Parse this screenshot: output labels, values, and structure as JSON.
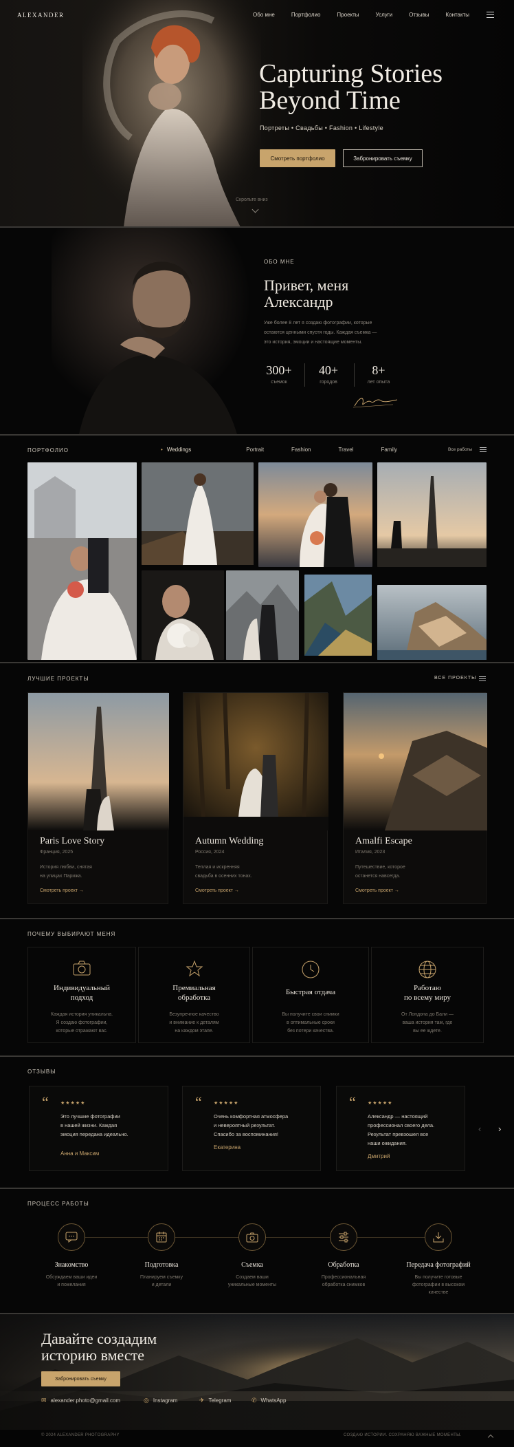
{
  "brand": "ALEXANDER",
  "nav": {
    "items": [
      "Обо мне",
      "Портфолио",
      "Проекты",
      "Услуги",
      "Отзывы",
      "Контакты"
    ]
  },
  "hero": {
    "title_line1": "Capturing Stories",
    "title_line2": "Beyond Time",
    "subtitle": "Портреты • Свадьбы • Fashion • Lifestyle",
    "primary_button": "Смотреть портфолио",
    "secondary_button": "Забронировать съемку",
    "scroll_hint": "Скрольте вниз"
  },
  "about": {
    "label": "ОБО МНЕ",
    "title_line1": "Привет, меня",
    "title_line2": "Александр",
    "text_line1": "Уже более 8 лет я создаю фотографии, которые",
    "text_line2": "остаются ценными спустя годы. Каждая съемка —",
    "text_line3": "это история, эмоции и настоящие моменты.",
    "stats": [
      {
        "value": "300+",
        "label": "съемок"
      },
      {
        "value": "40+",
        "label": "городов"
      },
      {
        "value": "8+",
        "label": "лет опыта"
      }
    ]
  },
  "portfolio": {
    "label": "ПОРТФОЛИО",
    "tabs": [
      "Weddings",
      "Portrait",
      "Fashion",
      "Travel",
      "Family"
    ],
    "active_tab": "Weddings",
    "all_link": "Все работы"
  },
  "projects": {
    "label": "ЛУЧШИЕ ПРОЕКТЫ",
    "all_link": "ВСЕ ПРОЕКТЫ",
    "cards": [
      {
        "title": "Paris Love Story",
        "location": "Франция, 2025",
        "desc1": "История любви, снятая",
        "desc2": "на улицах Парижа.",
        "link": "Смотреть проект →"
      },
      {
        "title": "Autumn Wedding",
        "location": "Россия, 2024",
        "desc1": "Теплая и искренняя",
        "desc2": "свадьба в осенних тонах.",
        "link": "Смотреть проект →"
      },
      {
        "title": "Amalfi Escape",
        "location": "Италия, 2023",
        "desc1": "Путешествие, которое",
        "desc2": "останется навсегда.",
        "link": "Смотреть проект →"
      }
    ]
  },
  "why": {
    "label": "ПОЧЕМУ ВЫБИРАЮТ МЕНЯ",
    "items": [
      {
        "icon": "camera-icon",
        "title1": "Индивидуальный",
        "title2": "подход",
        "d1": "Каждая история уникальна.",
        "d2": "Я создаю фотографии,",
        "d3": "которые отражают вас."
      },
      {
        "icon": "star-icon",
        "title1": "Премиальная",
        "title2": "обработка",
        "d1": "Безупречное качество",
        "d2": "и внимание к деталям",
        "d3": "на каждом этапе."
      },
      {
        "icon": "clock-icon",
        "title1": "Быстрая отдача",
        "title2": "",
        "d1": "Вы получите свои снимки",
        "d2": "в оптимальные сроки",
        "d3": "без потери качества."
      },
      {
        "icon": "globe-icon",
        "title1": "Работаю",
        "title2": "по всему миру",
        "d1": "От Лондона до Бали —",
        "d2": "ваша история там, где",
        "d3": "вы ее ждете."
      }
    ]
  },
  "reviews": {
    "label": "ОТЗЫВЫ",
    "stars": "★★★★★",
    "items": [
      {
        "l1": "Это лучшие фотографии",
        "l2": "в нашей жизни. Каждая",
        "l3": "эмоция передана идеально.",
        "l4": "",
        "author": "Анна и Максим"
      },
      {
        "l1": "Очень комфортная атмосфера",
        "l2": "и невероятный результат.",
        "l3": "Спасибо за воспоминания!",
        "l4": "",
        "author": "Екатерина"
      },
      {
        "l1": "Александр — настоящий",
        "l2": "профессионал своего дела.",
        "l3": "Результат превзошел все",
        "l4": "наши ожидания.",
        "author": "Дмитрий"
      }
    ]
  },
  "process": {
    "label": "ПРОЦЕСС РАБОТЫ",
    "steps": [
      {
        "icon": "chat-icon",
        "title": "Знакомство",
        "d1": "Обсуждаем ваши идеи",
        "d2": "и пожелания",
        "d3": ""
      },
      {
        "icon": "calendar-icon",
        "title": "Подготовка",
        "d1": "Планируем съемку",
        "d2": "и детали",
        "d3": ""
      },
      {
        "icon": "camera-icon",
        "title": "Съемка",
        "d1": "Создаем ваши",
        "d2": "уникальные моменты",
        "d3": ""
      },
      {
        "icon": "sliders-icon",
        "title": "Обработка",
        "d1": "Профессиональная",
        "d2": "обработка снимков",
        "d3": ""
      },
      {
        "icon": "download-icon",
        "title": "Передача фотографий",
        "d1": "Вы получите готовые",
        "d2": "фотографии в высоком",
        "d3": "качестве"
      }
    ]
  },
  "cta": {
    "title_line1": "Давайте создадим",
    "title_line2": "историю вместе",
    "button": "Забронировать съемку",
    "email": "alexander.photo@gmail.com",
    "instagram": "Instagram",
    "telegram": "Telegram",
    "whatsapp": "WhatsApp"
  },
  "footer": {
    "copyright": "© 2024 ALEXANDER PHOTOGRAPHY",
    "tagline": "СОЗДАЮ ИСТОРИИ. СОХРАНЯЮ ВАЖНЫЕ МОМЕНТЫ."
  },
  "colors": {
    "accent": "#c8a46c",
    "background": "#070707",
    "text": "#e9e4dc"
  }
}
